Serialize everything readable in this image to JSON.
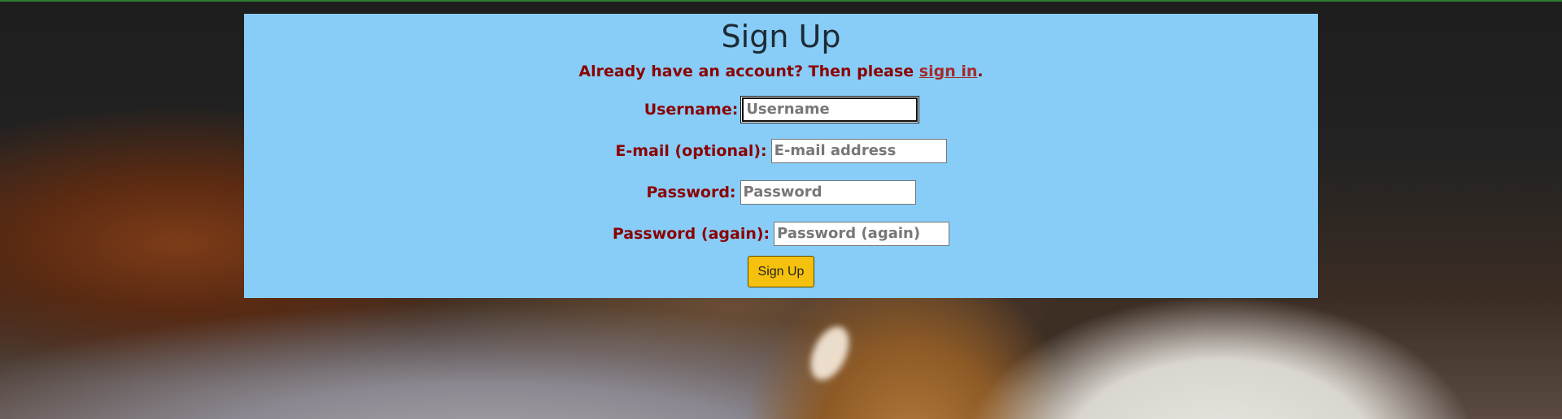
{
  "page": {
    "title": "Sign Up",
    "signin_prompt": "Already have an account? Then please",
    "signin_link": "sign in",
    "signin_suffix": "."
  },
  "form": {
    "fields": [
      {
        "label": "Username:",
        "placeholder": "Username",
        "focused": true
      },
      {
        "label": "E-mail (optional):",
        "placeholder": "E-mail address"
      },
      {
        "label": "Password:",
        "placeholder": "Password"
      },
      {
        "label": "Password (again):",
        "placeholder": "Password (again)"
      }
    ],
    "submit_label": "Sign Up"
  },
  "colors": {
    "panel_bg": "#87cdf8",
    "label_text": "#8b0000",
    "button_bg": "#f6c10d"
  }
}
